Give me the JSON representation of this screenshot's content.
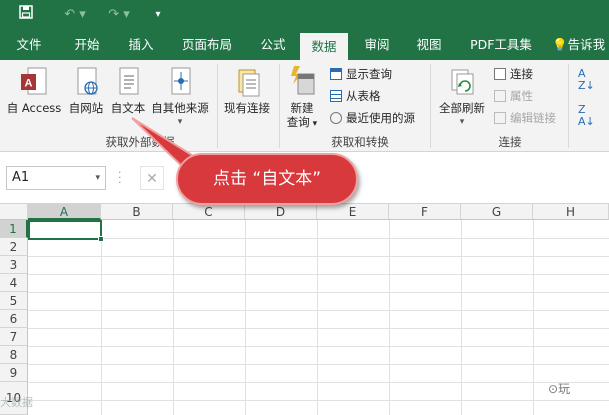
{
  "qat": {
    "save_icon": "save-icon",
    "undo_icon": "undo-icon",
    "redo_icon": "redo-icon",
    "customize_icon": "customize-qat-icon"
  },
  "tabs": [
    "文件",
    "开始",
    "插入",
    "页面布局",
    "公式",
    "数据",
    "审阅",
    "视图",
    "PDF工具集"
  ],
  "active_tab": "数据",
  "tell_me": "告诉我",
  "ribbon": {
    "get_external": {
      "label": "获取外部数据",
      "buttons": [
        "自 Access",
        "自网站",
        "自文本",
        "自其他来源"
      ],
      "other_source_arrow": "▾"
    },
    "existing": "现有连接",
    "new_query": {
      "line1": "新建",
      "line2": "查询"
    },
    "transform": {
      "label": "获取和转换",
      "items": [
        "显示查询",
        "从表格",
        "最近使用的源"
      ]
    },
    "refresh_all": "全部刷新",
    "connections": {
      "label": "连接",
      "items": [
        "连接",
        "属性",
        "编辑链接"
      ]
    }
  },
  "formula_bar": {
    "name_box": "A1",
    "cancel": "✕"
  },
  "grid": {
    "columns": [
      "A",
      "B",
      "C",
      "D",
      "E",
      "F",
      "G",
      "H"
    ],
    "rows": [
      "1",
      "2",
      "3",
      "4",
      "5",
      "6",
      "7",
      "8",
      "9",
      "10"
    ],
    "selected_cell": "A1"
  },
  "callout": "点击 “自文本”",
  "watermark": {
    "left": "大数据",
    "right": "玩"
  },
  "colors": {
    "excel_green": "#217346",
    "callout_red": "#d8393c",
    "selection": "#217346"
  }
}
